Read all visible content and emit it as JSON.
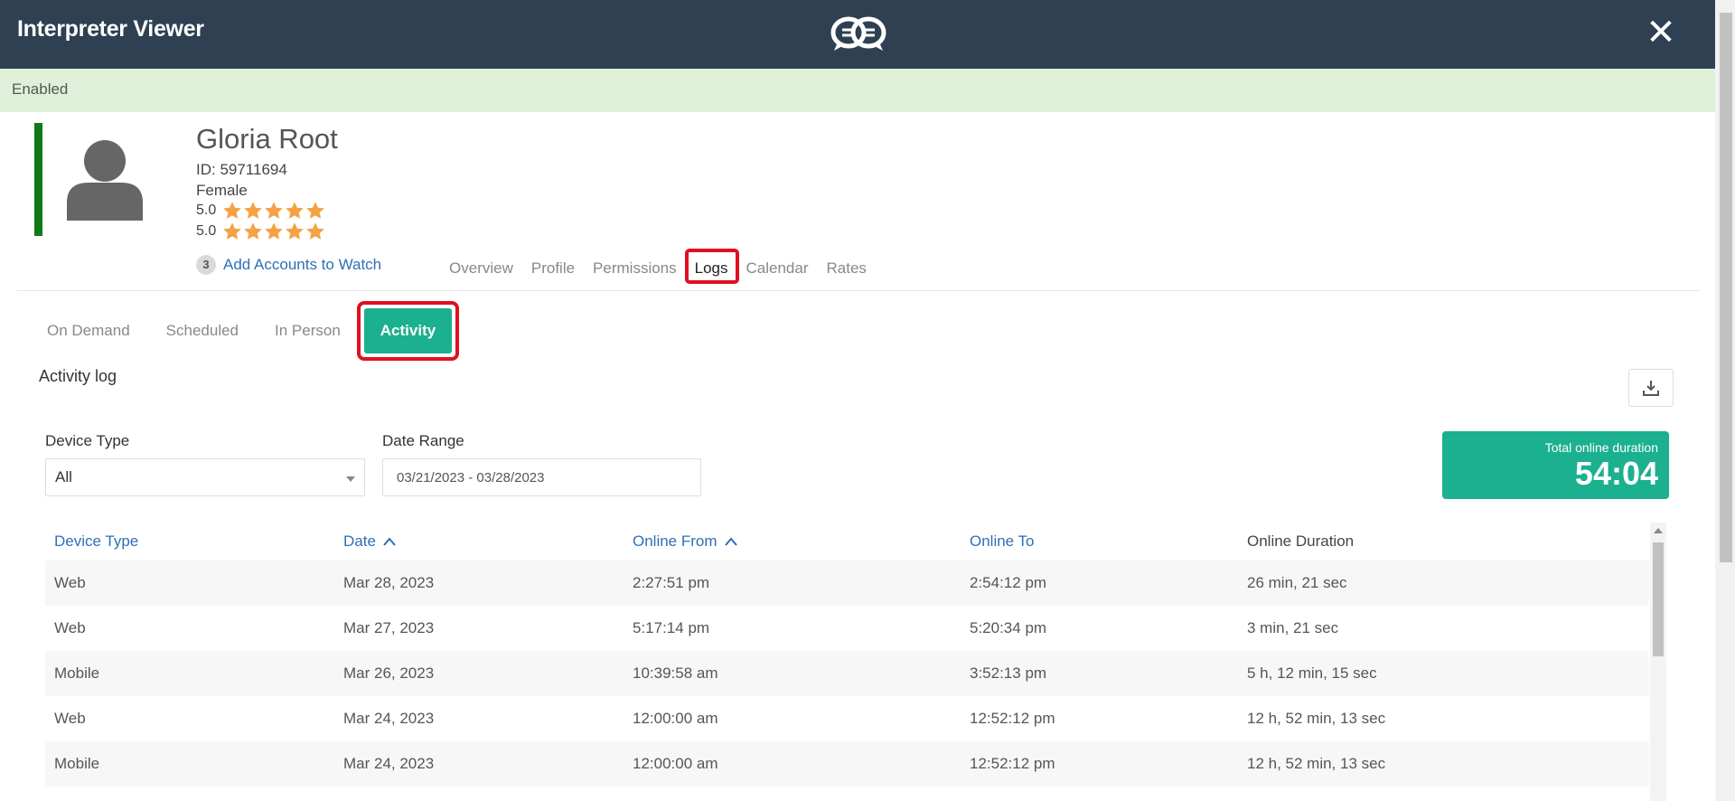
{
  "app": {
    "title": "Interpreter Viewer",
    "logo_icon": "chat-bubbles-logo-icon",
    "close_symbol": "✕"
  },
  "status": {
    "text": "Enabled",
    "color": "#dff0d8"
  },
  "profile": {
    "name": "Gloria Root",
    "id_text": "ID: 59711694",
    "gender": "Female",
    "ratings": [
      {
        "value": "5.0",
        "stars": 5
      },
      {
        "value": "5.0",
        "stars": 5
      }
    ],
    "watch_count": "3",
    "watch_label": "Add Accounts to Watch",
    "status_color": "#0f7a16"
  },
  "main_tabs": [
    "Overview",
    "Profile",
    "Permissions",
    "Logs",
    "Calendar",
    "Rates"
  ],
  "main_tabs_active": "Logs",
  "sub_tabs": [
    "On Demand",
    "Scheduled",
    "In Person",
    "Activity"
  ],
  "sub_tabs_active": "Activity",
  "activity": {
    "title": "Activity log",
    "download_icon": "download-icon",
    "filters": {
      "device_label": "Device Type",
      "device_value": "All",
      "date_label": "Date Range",
      "date_value": "03/21/2023 - 03/28/2023"
    },
    "total": {
      "label": "Total online duration",
      "value": "54:04",
      "color": "#1bb08f"
    }
  },
  "table": {
    "headers": [
      "Device Type",
      "Date",
      "Online From",
      "Online To",
      "Online Duration"
    ],
    "rows": [
      [
        "Web",
        "Mar 28, 2023",
        "2:27:51 pm",
        "2:54:12 pm",
        "26 min, 21 sec"
      ],
      [
        "Web",
        "Mar 27, 2023",
        "5:17:14 pm",
        "5:20:34 pm",
        "3 min, 21 sec"
      ],
      [
        "Mobile",
        "Mar 26, 2023",
        "10:39:58 am",
        "3:52:13 pm",
        "5 h, 12 min, 15 sec"
      ],
      [
        "Web",
        "Mar 24, 2023",
        "12:00:00 am",
        "12:52:12 pm",
        "12 h, 52 min, 13 sec"
      ],
      [
        "Mobile",
        "Mar 24, 2023",
        "12:00:00 am",
        "12:52:12 pm",
        "12 h, 52 min, 13 sec"
      ]
    ]
  },
  "colors": {
    "header_bg": "#2f4052",
    "accent": "#1bb08f",
    "link": "#2f6fb7",
    "highlight": "#e01020",
    "star": "#f5a146"
  }
}
